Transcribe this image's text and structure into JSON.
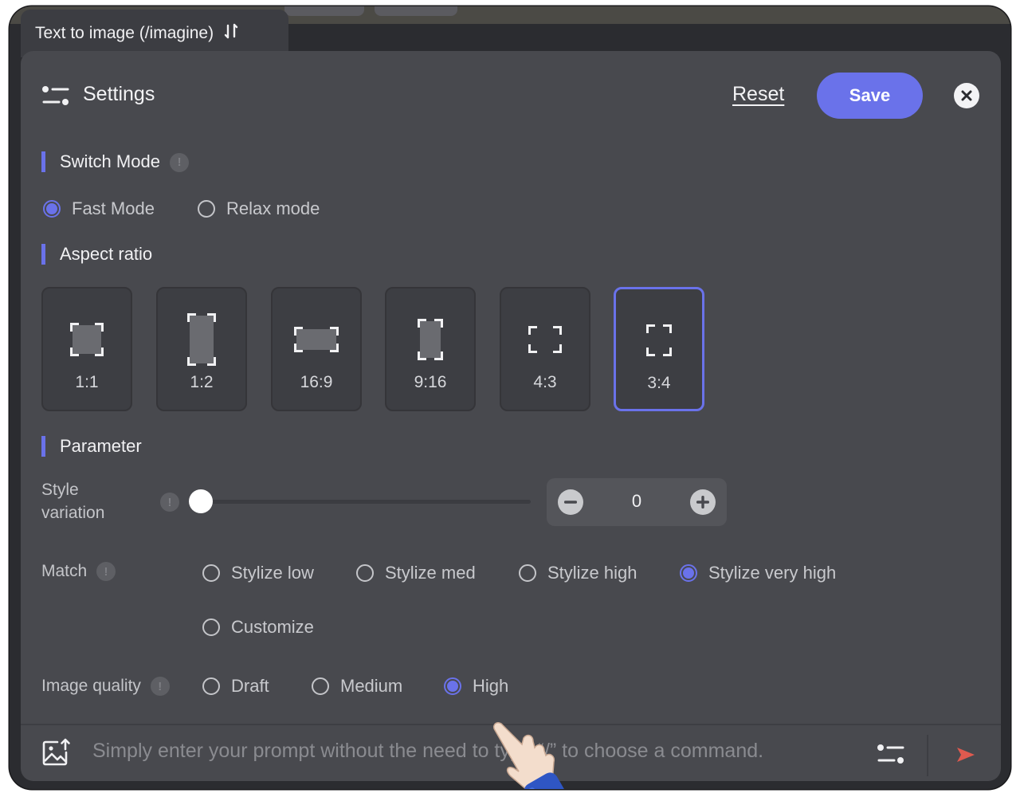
{
  "tab": {
    "title": "Text to image (/imagine)",
    "swap_icon": "swap-vertical-icon"
  },
  "header": {
    "title": "Settings",
    "settings_icon": "sliders-icon",
    "reset_label": "Reset",
    "save_label": "Save",
    "close_icon": "close-icon"
  },
  "colors": {
    "accent": "#6a72ea",
    "panel": "#48494e",
    "send": "#e05a4f"
  },
  "switch_mode": {
    "label": "Switch Mode",
    "info_icon": "!",
    "options": [
      {
        "label": "Fast Mode",
        "checked": true
      },
      {
        "label": "Relax mode",
        "checked": false
      }
    ]
  },
  "aspect_ratio": {
    "label": "Aspect ratio",
    "options": [
      "1:1",
      "1:2",
      "16:9",
      "9:16",
      "4:3",
      "3:4"
    ],
    "selected": "3:4"
  },
  "parameter": {
    "label": "Parameter",
    "style_variation": {
      "label_line1": "Style",
      "label_line2": "variation",
      "info_icon": "!",
      "value": "0",
      "slider_fraction": 0
    },
    "match": {
      "label": "Match",
      "info_icon": "!",
      "options": [
        {
          "label": "Stylize low",
          "checked": false
        },
        {
          "label": "Stylize med",
          "checked": false
        },
        {
          "label": "Stylize high",
          "checked": false
        },
        {
          "label": "Stylize very high",
          "checked": true
        },
        {
          "label": "Customize",
          "checked": false
        }
      ]
    },
    "image_quality": {
      "label": "Image quality",
      "info_icon": "!",
      "options": [
        {
          "label": "Draft",
          "checked": false
        },
        {
          "label": "Medium",
          "checked": false
        },
        {
          "label": "High",
          "checked": true
        }
      ]
    }
  },
  "prompt_bar": {
    "placeholder": "Simply enter your prompt without the need to type “/” to choose a command.",
    "upload_icon": "image-upload-icon",
    "settings_icon": "sliders-icon",
    "send_icon": "send-icon"
  }
}
